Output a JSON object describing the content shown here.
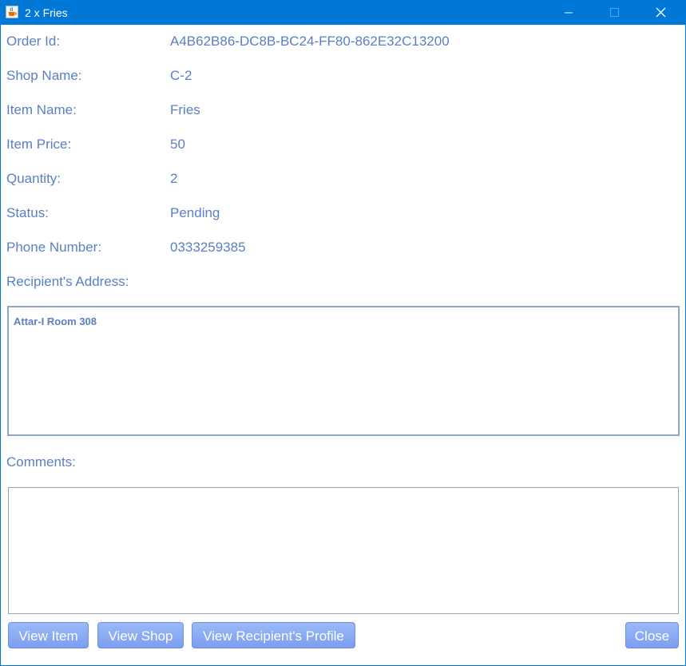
{
  "window": {
    "title": "2 x Fries",
    "app_icon": "java-cup-icon",
    "controls": {
      "minimize": "minimize-icon",
      "maximize": "maximize-icon",
      "close": "close-icon"
    },
    "accent_color": "#0078d7"
  },
  "fields": {
    "order_id": {
      "label": "Order Id:",
      "value": "A4B62B86-DC8B-BC24-FF80-862E32C13200"
    },
    "shop_name": {
      "label": "Shop Name:",
      "value": "C-2"
    },
    "item_name": {
      "label": "Item Name:",
      "value": "Fries"
    },
    "item_price": {
      "label": "Item Price:",
      "value": "50"
    },
    "quantity": {
      "label": "Quantity:",
      "value": "2"
    },
    "status": {
      "label": "Status:",
      "value": "Pending"
    },
    "phone_number": {
      "label": "Phone Number:",
      "value": "0333259385"
    }
  },
  "address": {
    "label": "Recipient's Address:",
    "value": "Attar-I Room 308"
  },
  "comments": {
    "label": "Comments:",
    "value": ""
  },
  "buttons": {
    "view_item": "View Item",
    "view_shop": "View Shop",
    "view_profile": "View Recipient's Profile",
    "close": "Close"
  },
  "colors": {
    "text": "#5a7fc4",
    "button": "#8aabf5"
  }
}
